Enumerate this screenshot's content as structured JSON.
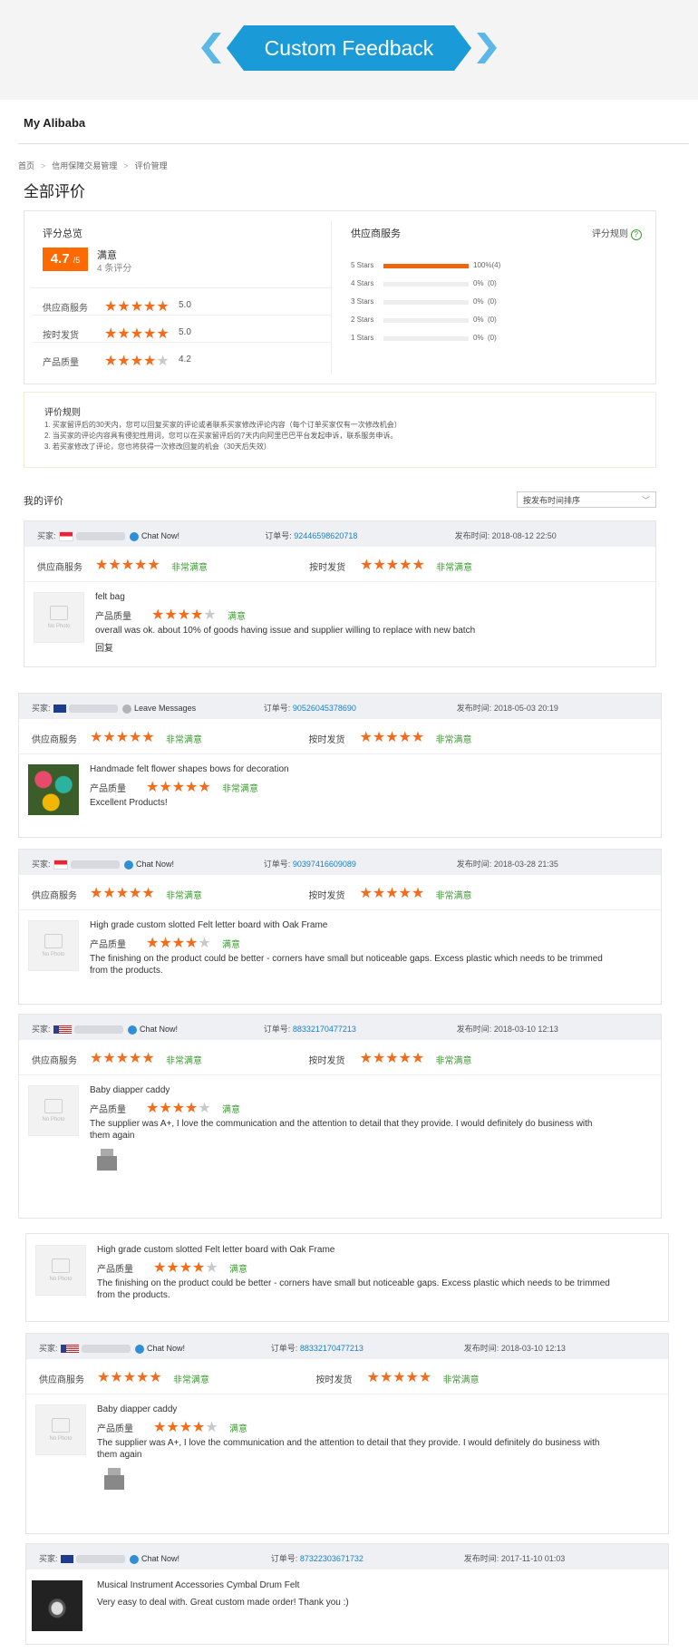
{
  "banner": {
    "title": "Custom Feedback"
  },
  "header": {
    "brand": "My Alibaba"
  },
  "breadcrumb": [
    "首页",
    "信用保障交易管理",
    "评价管理"
  ],
  "page_title": "全部评价",
  "overview": {
    "label": "评分总览",
    "score": "4.7",
    "score_suffix": "/5",
    "rating_word": "满意",
    "count": "4 条评分",
    "metrics": [
      {
        "label": "供应商服务",
        "stars": 5,
        "value": "5.0"
      },
      {
        "label": "按时发货",
        "stars": 5,
        "value": "5.0"
      },
      {
        "label": "产品质量",
        "stars": 4,
        "value": "4.2"
      }
    ]
  },
  "supplier_service": {
    "label": "供应商服务",
    "rule_link": "评分规则",
    "distribution": [
      {
        "label": "5 Stars",
        "fraction": 1.0,
        "text": "100%(4)"
      },
      {
        "label": "4 Stars",
        "fraction": 0,
        "text": "0%  (0)"
      },
      {
        "label": "3 Stars",
        "fraction": 0,
        "text": "0%  (0)"
      },
      {
        "label": "2 Stars",
        "fraction": 0,
        "text": "0%  (0)"
      },
      {
        "label": "1 Stars",
        "fraction": 0,
        "text": "0%  (0)"
      }
    ]
  },
  "rules": {
    "title": "评价规则",
    "lines": [
      "1. 买家留评后的30天内，您可以回复买家的评论或者联系买家修改评论内容（每个订单买家仅有一次修改机会）",
      "2. 当买家的评论内容具有侵犯性用词，您可以在买家留评后的7天内向阿里巴巴平台发起申诉，联系服务申诉。",
      "3. 若买家修改了评论，您也将获得一次修改回复的机会（30天后失效）"
    ]
  },
  "my_reviews": {
    "title": "我的评价",
    "sort_label": "按发布时间排序"
  },
  "labels": {
    "buyer": "买家:",
    "order": "订单号:",
    "time": "发布时间:",
    "supplier_service": "供应商服务",
    "on_time": "按时发货",
    "quality": "产品质量",
    "very_satisfied": "非常满意",
    "satisfied": "满意",
    "reply": "回复",
    "no_photo": "No Photo"
  },
  "reviews": [
    {
      "contact": "Chat Now!",
      "order_no": "92446598620718",
      "time": "2018-08-12 22:50",
      "product": "felt bag",
      "quality_stars": 4,
      "comment": "overall was ok. about 10% of goods having issue and supplier willing to replace with new batch",
      "flag": "sg"
    },
    {
      "contact": "Leave Messages",
      "order_no": "90526045378690",
      "time": "2018-05-03 20:19",
      "product": "Handmade felt flower shapes bows for decoration",
      "quality_stars": 5,
      "comment": "Excellent Products!",
      "flag": "au"
    },
    {
      "contact": "Chat Now!",
      "order_no": "90397416609089",
      "time": "2018-03-28 21:35",
      "product": "High grade custom slotted Felt letter board with Oak Frame",
      "quality_stars": 4,
      "comment": "The finishing on the product could be better - corners have small but noticeable gaps. Excess plastic which needs to be trimmed",
      "comment2": "from the products.",
      "flag": "sg"
    },
    {
      "contact": "Chat Now!",
      "order_no": "88332170477213",
      "time": "2018-03-10 12:13",
      "product": "Baby diapper caddy",
      "quality_stars": 4,
      "comment": "The supplier was A+, I love the communication and the attention to detail that they provide. I would definitely do business with",
      "comment2": "them again",
      "flag": "us"
    },
    {
      "product": "High grade custom slotted Felt letter board with Oak Frame",
      "quality_stars": 4,
      "comment": "The finishing on the product could be better - corners have small but noticeable gaps. Excess plastic which needs to be trimmed",
      "comment2": "from the products."
    },
    {
      "contact": "Chat Now!",
      "order_no": "88332170477213",
      "time": "2018-03-10 12:13",
      "product": "Baby diapper caddy",
      "quality_stars": 4,
      "comment": "The supplier was A+, I love the communication and the attention to detail that they provide. I would definitely do business with",
      "comment2": "them again",
      "flag": "us"
    },
    {
      "contact": "Chat Now!",
      "order_no": "87322303671732",
      "time": "2017-11-10 01:03",
      "product": "Musical Instrument Accessories Cymbal Drum Felt",
      "comment": "Very easy to deal with. Great custom made order! Thank you :)",
      "flag": "au"
    }
  ],
  "colors": {
    "accent": "#ff6a00",
    "star": "#f26c1c",
    "link": "#1a7fc1",
    "green": "#3c9a31",
    "banner": "#1a9bd7"
  }
}
